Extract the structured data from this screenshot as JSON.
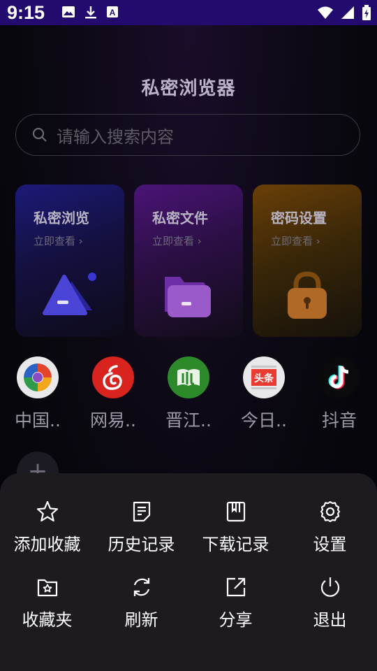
{
  "status_bar": {
    "time": "9:15",
    "left_icons": [
      "image-icon",
      "download-icon",
      "text-a-icon"
    ],
    "right_icons": [
      "wifi-icon",
      "signal-icon",
      "battery-icon"
    ],
    "bg_color": "#230a6e"
  },
  "header": {
    "title": "私密浏览器"
  },
  "search": {
    "placeholder": "请输入搜索内容"
  },
  "cards": [
    {
      "title": "私密浏览",
      "subtitle": "立即查看 ›",
      "icon": "mountain-image-icon",
      "accent": "#3b35d6"
    },
    {
      "title": "私密文件",
      "subtitle": "立即查看 ›",
      "icon": "folder-icon",
      "accent": "#8a3fcf"
    },
    {
      "title": "密码设置",
      "subtitle": "立即查看 ›",
      "icon": "padlock-icon",
      "accent": "#b26a1f"
    }
  ],
  "shortcuts": [
    {
      "label": "中国..",
      "icon": "china-site-logo-icon"
    },
    {
      "label": "网易..",
      "icon": "netease-music-logo-icon"
    },
    {
      "label": "晋江..",
      "icon": "jinjiang-logo-icon"
    },
    {
      "label": "今日..",
      "icon": "toutiao-logo-icon"
    },
    {
      "label": "抖音",
      "icon": "douyin-logo-icon"
    }
  ],
  "add_shortcut": {
    "label": "+"
  },
  "menu": {
    "items": [
      {
        "label": "添加收藏",
        "icon": "star-icon"
      },
      {
        "label": "历史记录",
        "icon": "history-doc-icon"
      },
      {
        "label": "下载记录",
        "icon": "download-record-icon"
      },
      {
        "label": "设置",
        "icon": "gear-icon"
      },
      {
        "label": "收藏夹",
        "icon": "favorites-folder-icon"
      },
      {
        "label": "刷新",
        "icon": "refresh-icon"
      },
      {
        "label": "分享",
        "icon": "share-icon"
      },
      {
        "label": "退出",
        "icon": "power-icon"
      }
    ]
  }
}
